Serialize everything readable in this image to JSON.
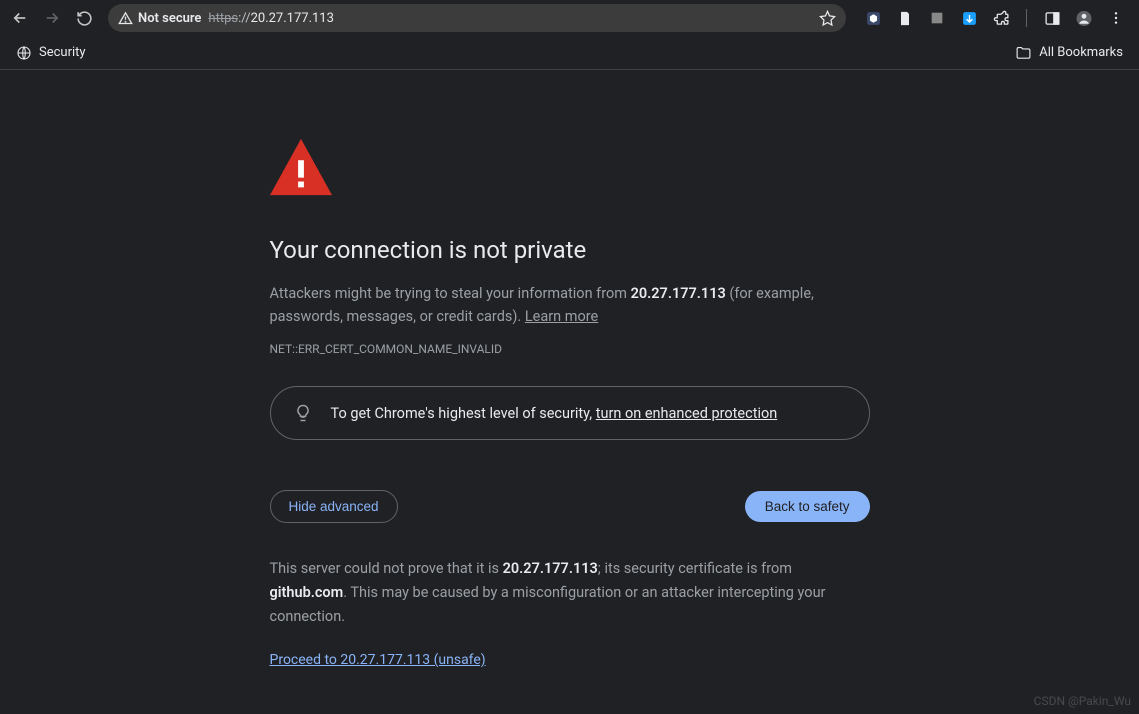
{
  "toolbar": {
    "not_secure_label": "Not secure",
    "url_scheme": "https",
    "url_sep": "://",
    "url_host": "20.27.177.113"
  },
  "bookmark_bar": {
    "item1": "Security",
    "all_bookmarks": "All Bookmarks"
  },
  "page": {
    "heading": "Your connection is not private",
    "msg_pre": "Attackers might be trying to steal your information from ",
    "msg_host": "20.27.177.113",
    "msg_post": " (for example, passwords, messages, or credit cards). ",
    "learn_more": "Learn more",
    "error_code": "NET::ERR_CERT_COMMON_NAME_INVALID",
    "promo_pre": "To get Chrome's highest level of security, ",
    "promo_link": "turn on enhanced protection",
    "hide_advanced": "Hide advanced",
    "back_to_safety": "Back to safety",
    "adv_pre": "This server could not prove that it is ",
    "adv_host": "20.27.177.113",
    "adv_mid": "; its security certificate is from ",
    "adv_domain": "github.com",
    "adv_post": ". This may be caused by a misconfiguration or an attacker intercepting your connection.",
    "proceed": "Proceed to 20.27.177.113 (unsafe)"
  },
  "watermark": "CSDN @Pakin_Wu"
}
